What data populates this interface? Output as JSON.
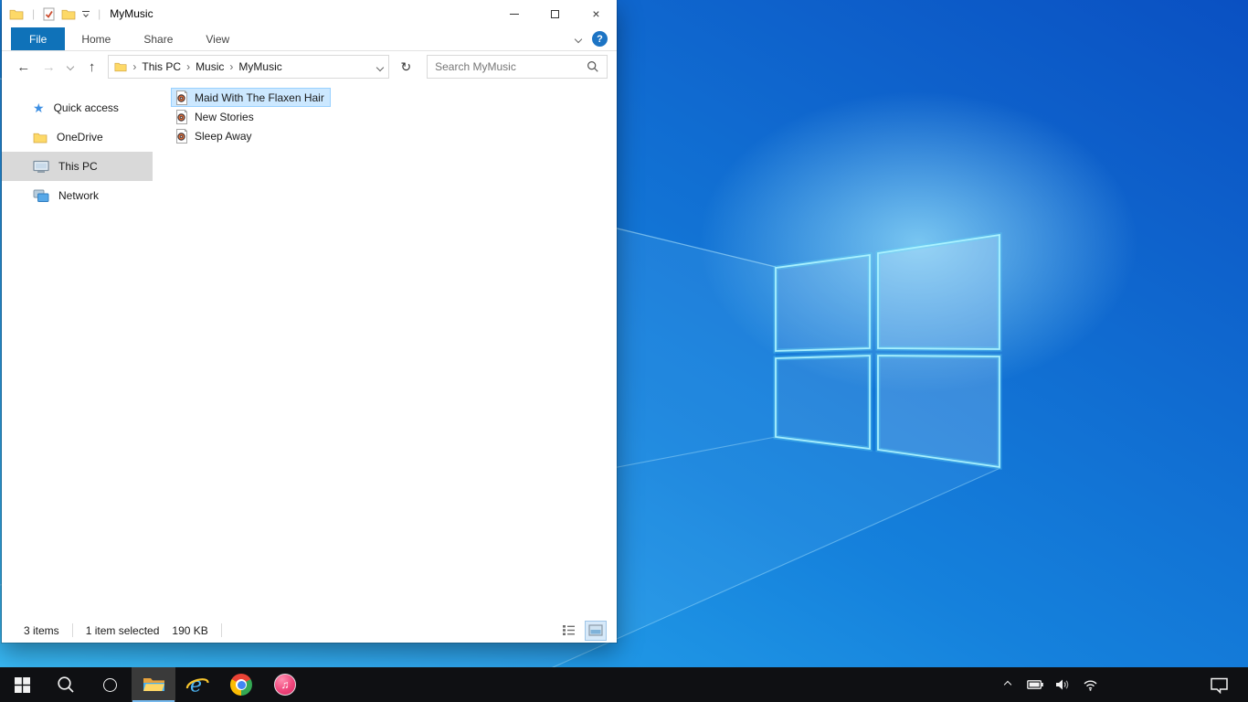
{
  "window": {
    "title": "MyMusic",
    "ribbon": {
      "tabs": [
        {
          "label": "File",
          "active": true
        },
        {
          "label": "Home",
          "active": false
        },
        {
          "label": "Share",
          "active": false
        },
        {
          "label": "View",
          "active": false
        }
      ]
    },
    "navigation": {
      "breadcrumb": [
        "This PC",
        "Music",
        "MyMusic"
      ],
      "search_placeholder": "Search MyMusic"
    },
    "sidebar": {
      "items": [
        {
          "label": "Quick access",
          "icon": "quick-access-star-icon",
          "selected": false
        },
        {
          "label": "OneDrive",
          "icon": "onedrive-folder-icon",
          "selected": false
        },
        {
          "label": "This PC",
          "icon": "this-pc-monitor-icon",
          "selected": true
        },
        {
          "label": "Network",
          "icon": "network-icon",
          "selected": false
        }
      ]
    },
    "files": {
      "items": [
        {
          "name": "Maid With The Flaxen Hair",
          "icon": "music-file-icon",
          "selected": true
        },
        {
          "name": "New Stories",
          "icon": "music-file-icon",
          "selected": false
        },
        {
          "name": "Sleep Away",
          "icon": "music-file-icon",
          "selected": false
        }
      ]
    },
    "statusbar": {
      "item_count": "3 items",
      "selection": "1 item selected",
      "size": "190 KB"
    }
  },
  "taskbar": {
    "buttons": [
      "start",
      "search",
      "cortana",
      "file-explorer",
      "internet-explorer",
      "chrome",
      "itunes"
    ],
    "active_button": "file-explorer",
    "tray_icons": [
      "hidden-icons-chevron",
      "battery",
      "volume",
      "wifi"
    ],
    "action_center": "action-center"
  },
  "icons": {
    "back": "←",
    "forward": "→",
    "up": "↑",
    "refresh": "↻",
    "breadcrumb_sep": "›",
    "close": "×",
    "star": "★",
    "note": "♫",
    "help": "?",
    "pipe": "|"
  },
  "colors": {
    "file_tab_accent": "#0f72b9",
    "selection_bg": "#cce8ff",
    "selection_border": "#99d1ff",
    "sidebar_selected": "#d9d9d9",
    "taskbar_bg": "#0f1013",
    "taskbar_active_underline": "#76b9ed",
    "wallpaper_bottom_left": "#2fb7f3",
    "wallpaper_top_right": "#0a50c2"
  }
}
